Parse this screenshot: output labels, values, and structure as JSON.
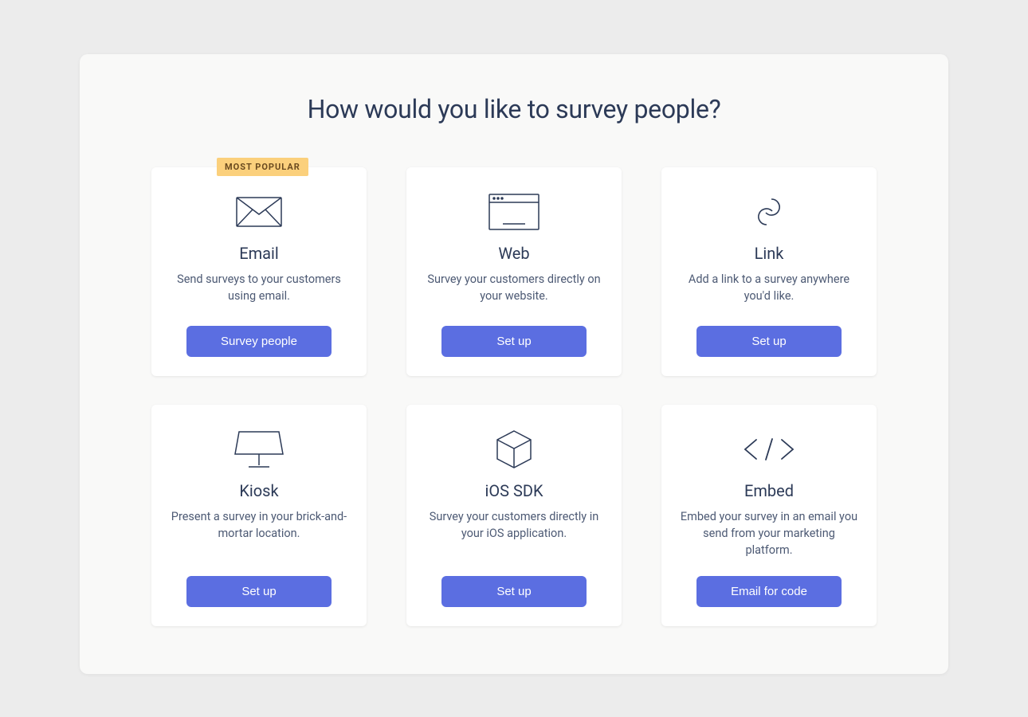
{
  "heading": "How would you like to survey people?",
  "badge": "MOST POPULAR",
  "cards": [
    {
      "title": "Email",
      "desc": "Send surveys to your customers using email.",
      "button": "Survey people"
    },
    {
      "title": "Web",
      "desc": "Survey your customers directly on your website.",
      "button": "Set up"
    },
    {
      "title": "Link",
      "desc": "Add a link to a survey anywhere you'd like.",
      "button": "Set up"
    },
    {
      "title": "Kiosk",
      "desc": "Present a survey in your brick-and-mortar location.",
      "button": "Set up"
    },
    {
      "title": "iOS SDK",
      "desc": "Survey your customers directly in your iOS application.",
      "button": "Set up"
    },
    {
      "title": "Embed",
      "desc": "Embed your survey in an email you send from your marketing platform.",
      "button": "Email for code"
    }
  ],
  "colors": {
    "accent": "#5b6ee1",
    "badge_bg": "#fbd07c",
    "text": "#2c3a57"
  }
}
